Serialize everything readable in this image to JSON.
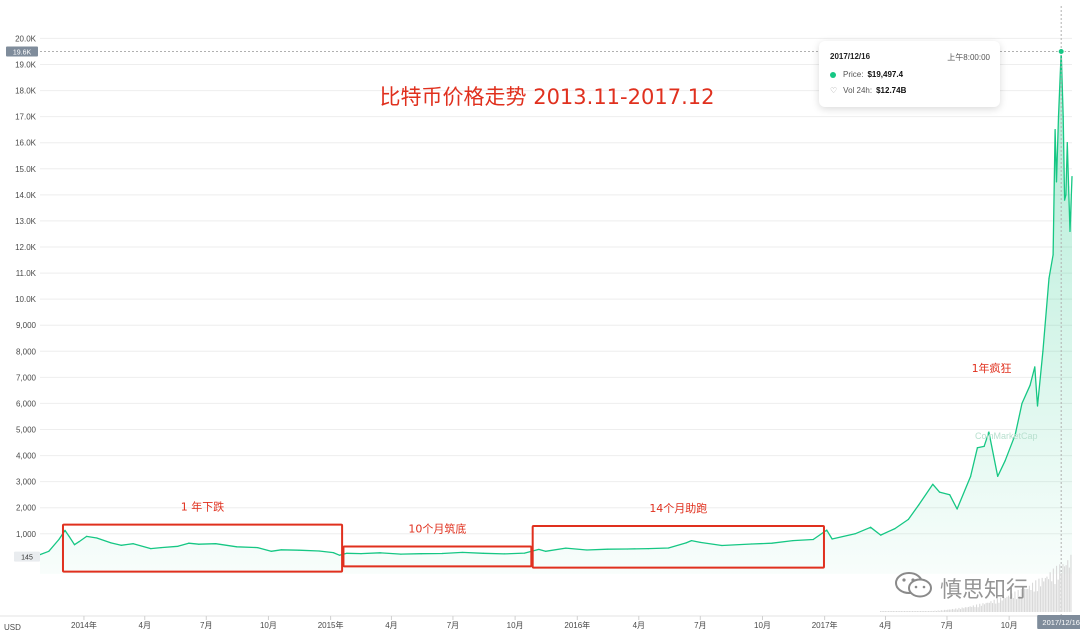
{
  "chart_data": {
    "type": "line",
    "title": "比特币价格走势 2013.11-2017.12",
    "currency_label": "USD",
    "y_ticks": [
      "1,000",
      "2,000",
      "3,000",
      "4,000",
      "5,000",
      "6,000",
      "7,000",
      "8,000",
      "9,000",
      "10.0K",
      "11.0K",
      "12.0K",
      "13.0K",
      "14.0K",
      "15.0K",
      "16.0K",
      "17.0K",
      "18.0K",
      "19.0K",
      "20.0K"
    ],
    "y_tick_values": [
      1000,
      2000,
      3000,
      4000,
      5000,
      6000,
      7000,
      8000,
      9000,
      10000,
      11000,
      12000,
      13000,
      14000,
      15000,
      16000,
      17000,
      18000,
      19000,
      20000
    ],
    "ylim": [
      -2000,
      20400
    ],
    "x_ticks": [
      "2014年",
      "4月",
      "7月",
      "10月",
      "2015年",
      "4月",
      "7月",
      "10月",
      "2016年",
      "4月",
      "7月",
      "10月",
      "2017年",
      "4月",
      "7月",
      "10月"
    ],
    "x_tick_dates": [
      "2014-01-01",
      "2014-04-01",
      "2014-07-01",
      "2014-10-01",
      "2015-01-01",
      "2015-04-01",
      "2015-07-01",
      "2015-10-01",
      "2016-01-01",
      "2016-04-01",
      "2016-07-01",
      "2016-10-01",
      "2017-01-01",
      "2017-04-01",
      "2017-07-01",
      "2017-10-01"
    ],
    "xlim": [
      "2013-10-28",
      "2018-01-02"
    ],
    "price_marker_left": "145",
    "price_marker_right": "19.6K",
    "crosshair_label": "2017/12/16",
    "grid": true,
    "series": [
      {
        "values": [
          [
            "2013-10-28",
            200
          ],
          [
            "2013-11-10",
            330
          ],
          [
            "2013-11-25",
            780
          ],
          [
            "2013-12-04",
            1130
          ],
          [
            "2013-12-10",
            900
          ],
          [
            "2013-12-18",
            580
          ],
          [
            "2013-12-25",
            700
          ],
          [
            "2014-01-05",
            900
          ],
          [
            "2014-01-20",
            840
          ],
          [
            "2014-02-10",
            650
          ],
          [
            "2014-02-25",
            560
          ],
          [
            "2014-03-15",
            620
          ],
          [
            "2014-04-10",
            430
          ],
          [
            "2014-04-25",
            470
          ],
          [
            "2014-05-20",
            520
          ],
          [
            "2014-06-05",
            640
          ],
          [
            "2014-06-20",
            600
          ],
          [
            "2014-07-15",
            620
          ],
          [
            "2014-08-15",
            500
          ],
          [
            "2014-09-15",
            470
          ],
          [
            "2014-10-05",
            330
          ],
          [
            "2014-10-20",
            385
          ],
          [
            "2014-11-15",
            370
          ],
          [
            "2014-12-15",
            340
          ],
          [
            "2015-01-05",
            280
          ],
          [
            "2015-01-14",
            180
          ],
          [
            "2015-01-25",
            250
          ],
          [
            "2015-02-15",
            240
          ],
          [
            "2015-03-15",
            270
          ],
          [
            "2015-04-15",
            220
          ],
          [
            "2015-05-15",
            235
          ],
          [
            "2015-06-15",
            245
          ],
          [
            "2015-07-15",
            285
          ],
          [
            "2015-08-15",
            250
          ],
          [
            "2015-09-15",
            230
          ],
          [
            "2015-10-15",
            260
          ],
          [
            "2015-11-05",
            400
          ],
          [
            "2015-11-15",
            330
          ],
          [
            "2015-12-15",
            450
          ],
          [
            "2016-01-15",
            380
          ],
          [
            "2016-02-15",
            410
          ],
          [
            "2016-03-15",
            415
          ],
          [
            "2016-04-15",
            430
          ],
          [
            "2016-05-15",
            455
          ],
          [
            "2016-06-10",
            650
          ],
          [
            "2016-06-18",
            740
          ],
          [
            "2016-07-01",
            670
          ],
          [
            "2016-08-02",
            550
          ],
          [
            "2016-09-15",
            610
          ],
          [
            "2016-10-15",
            640
          ],
          [
            "2016-11-15",
            740
          ],
          [
            "2016-12-15",
            780
          ],
          [
            "2017-01-04",
            1140
          ],
          [
            "2017-01-12",
            800
          ],
          [
            "2017-02-15",
            1000
          ],
          [
            "2017-03-10",
            1250
          ],
          [
            "2017-03-25",
            950
          ],
          [
            "2017-04-15",
            1200
          ],
          [
            "2017-05-05",
            1550
          ],
          [
            "2017-05-20",
            2100
          ],
          [
            "2017-06-10",
            2900
          ],
          [
            "2017-06-20",
            2600
          ],
          [
            "2017-07-05",
            2500
          ],
          [
            "2017-07-16",
            1950
          ],
          [
            "2017-08-05",
            3200
          ],
          [
            "2017-08-15",
            4300
          ],
          [
            "2017-08-25",
            4350
          ],
          [
            "2017-09-01",
            4900
          ],
          [
            "2017-09-14",
            3200
          ],
          [
            "2017-09-25",
            3800
          ],
          [
            "2017-10-10",
            4800
          ],
          [
            "2017-10-20",
            6000
          ],
          [
            "2017-11-01",
            6700
          ],
          [
            "2017-11-08",
            7400
          ],
          [
            "2017-11-12",
            5900
          ],
          [
            "2017-11-20",
            8000
          ],
          [
            "2017-11-29",
            10800
          ],
          [
            "2017-12-05",
            11700
          ],
          [
            "2017-12-08",
            16500
          ],
          [
            "2017-12-10",
            14500
          ],
          [
            "2017-12-13",
            17000
          ],
          [
            "2017-12-17",
            19497
          ],
          [
            "2017-12-20",
            17000
          ],
          [
            "2017-12-22",
            13800
          ],
          [
            "2017-12-24",
            14000
          ],
          [
            "2017-12-26",
            16000
          ],
          [
            "2017-12-28",
            14300
          ],
          [
            "2017-12-30",
            12600
          ],
          [
            "2018-01-02",
            14700
          ]
        ]
      }
    ],
    "annotations": [
      {
        "text": "1 年下跌",
        "box": [
          "2013-12-01",
          "2015-01-18",
          1350,
          -450
        ]
      },
      {
        "text": "10个月筑底",
        "box": [
          "2015-01-20",
          "2015-10-25",
          510,
          -250
        ]
      },
      {
        "text": "14个月助跑",
        "box": [
          "2015-10-27",
          "2016-12-31",
          1300,
          -300
        ]
      },
      {
        "text": "1年疯狂",
        "at": [
          "2017-09-05",
          7200
        ]
      }
    ],
    "colors": {
      "line": "#16c784",
      "fill": "#16c784",
      "box": "#e0301e",
      "text": "#e0301e",
      "grid": "#eeeeee",
      "crosshair": "#b0b0b0",
      "tick": "#4a4a4a",
      "tag": "#7f8c9b"
    }
  },
  "tooltip": {
    "date": "2017/12/16",
    "time": "上午8:00:00",
    "price_label": "Price:",
    "price_value": "$19,497.4",
    "vol_label": "Vol 24h:",
    "vol_value": "$12.74B"
  },
  "watermark": {
    "cmc_text": "CoinMarketCap",
    "wechat_text": "慎思知行"
  }
}
